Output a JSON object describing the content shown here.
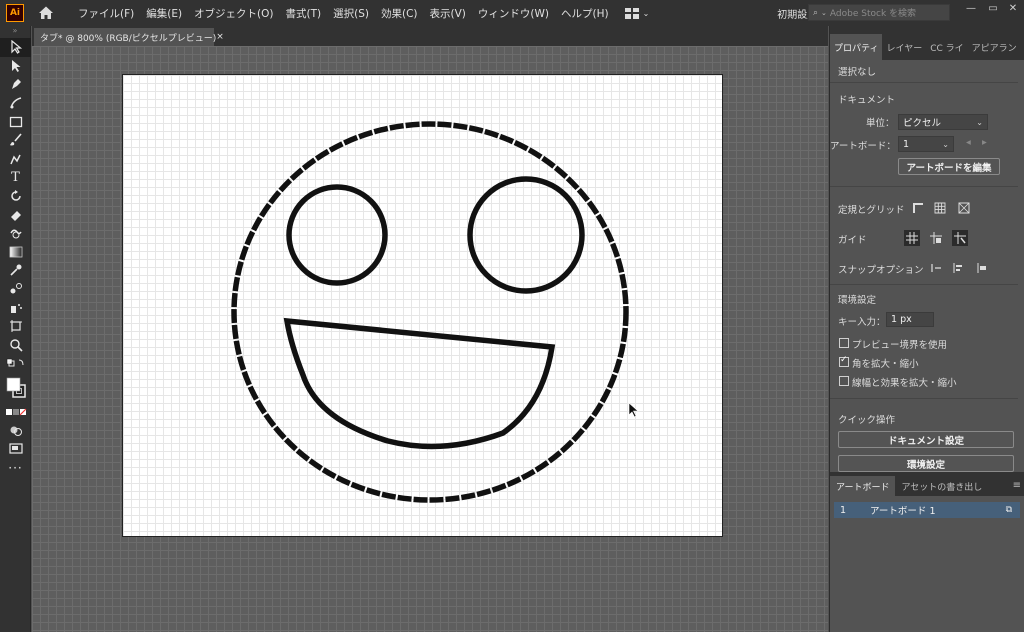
{
  "app": {
    "logo_text": "Ai",
    "menus": [
      "ファイル(F)",
      "編集(E)",
      "オブジェクト(O)",
      "書式(T)",
      "選択(S)",
      "効果(C)",
      "表示(V)",
      "ウィンドウ(W)",
      "ヘルプ(H)"
    ],
    "workspace_preset": "初期設定",
    "stock_search_placeholder": "Adobe Stock を検索"
  },
  "document": {
    "tab_title": "タブ* @ 800% (RGB/ピクセルプレビュー)",
    "tab_close": "×"
  },
  "panel": {
    "tabs": [
      "プロパティ",
      "レイヤー",
      "CC ライ",
      "アピアラン"
    ],
    "no_selection": "選択なし",
    "document_header": "ドキュメント",
    "unit_label": "単位：",
    "unit_value": "ピクセル",
    "artboard_label": "アートボード：",
    "artboard_value": "1",
    "edit_artboard_button": "アートボードを編集",
    "rulers_grids_label": "定規とグリッド",
    "guides_label": "ガイド",
    "snap_label": "スナップオプション",
    "prefs_header": "環境設定",
    "key_input_label": "キー入力：",
    "key_input_value": "1 px",
    "checkboxes": [
      {
        "label": "プレビュー境界を使用",
        "checked": false
      },
      {
        "label": "角を拡大・縮小",
        "checked": true
      },
      {
        "label": "線幅と効果を拡大・縮小",
        "checked": false
      }
    ],
    "quick_actions_header": "クイック操作",
    "doc_settings_button": "ドキュメント設定",
    "prefs_button": "環境設定"
  },
  "artboards_panel": {
    "tabs": [
      "アートボード",
      "アセットの書き出し"
    ],
    "rows": [
      {
        "index": "1",
        "name": "アートボード 1"
      }
    ]
  },
  "colors": {
    "ui_dark": "#323232",
    "ui_mid": "#535353",
    "accent_logo": "#ff9a00",
    "selection_row": "#46607a"
  }
}
